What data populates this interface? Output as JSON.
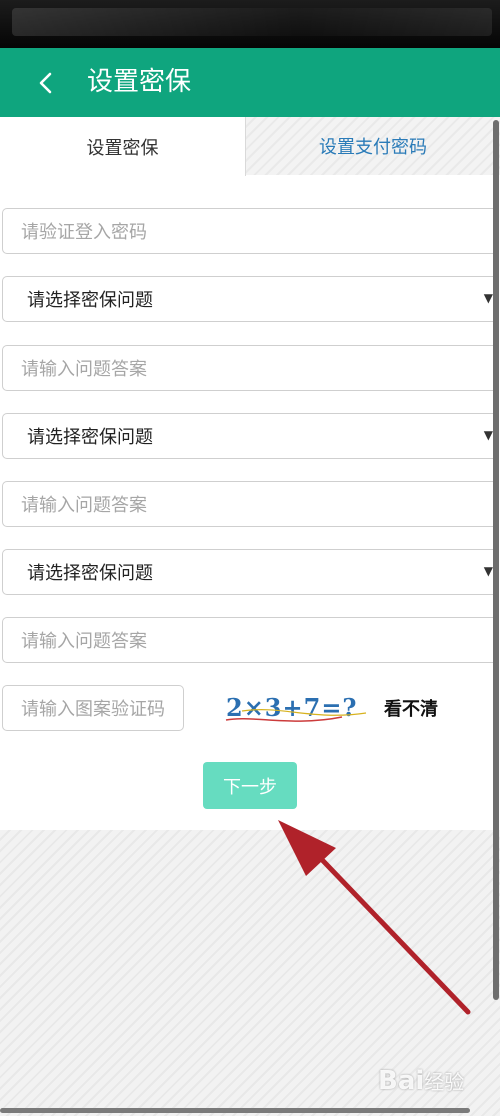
{
  "header": {
    "title": "设置密保",
    "back_icon": "chevron-left-icon"
  },
  "tabs": [
    {
      "label": "设置密保",
      "active": true
    },
    {
      "label": "设置支付密码",
      "active": false
    }
  ],
  "form": {
    "password_placeholder": "请验证登入密码",
    "question_label": "请选择密保问题",
    "answer_placeholder": "请输入问题答案",
    "captcha_placeholder": "请输入图案验证码",
    "captcha_text": "2×3+7=?",
    "refresh_label": "看不清",
    "next_label": "下一步"
  },
  "watermark": {
    "text": "Bai",
    "suffix": "经验"
  },
  "colors": {
    "primary": "#0fa57e",
    "button": "#66dcc0",
    "tab_link": "#2a7bb8",
    "arrow": "#b0222a"
  }
}
